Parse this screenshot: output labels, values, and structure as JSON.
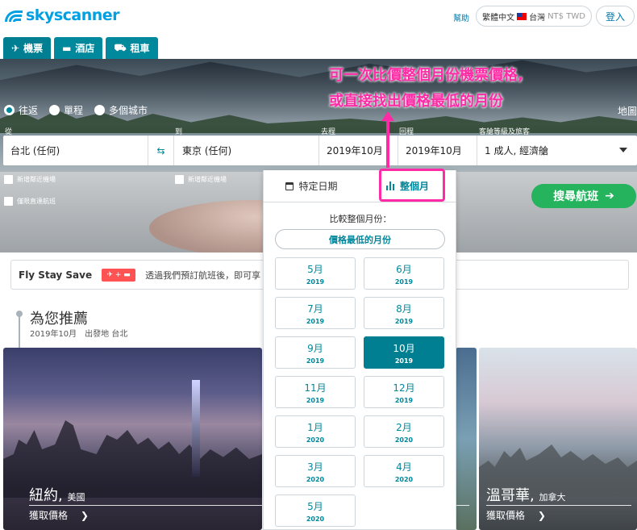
{
  "header": {
    "logo": "skyscanner",
    "help": "幫助",
    "locale": {
      "language": "繁體中文",
      "country": "台灣",
      "currency": "NT$ TWD"
    },
    "login": "登入"
  },
  "tabs": [
    {
      "label": "機票",
      "icon": "plane-icon"
    },
    {
      "label": "酒店",
      "icon": "bed-icon"
    },
    {
      "label": "租車",
      "icon": "car-icon"
    }
  ],
  "search": {
    "trip_types": [
      "往返",
      "單程",
      "多個城市"
    ],
    "trip_type_selected": "往返",
    "map": "地圖",
    "labels": {
      "from": "從",
      "to": "到",
      "depart": "去程",
      "return": "回程",
      "cabin": "客艙等級及旅客"
    },
    "from": "台北 (任何)",
    "to": "東京 (任何)",
    "depart": "2019年10月",
    "return": "2019年10月",
    "cabin": "1 成人, 經濟艙",
    "nearby_from": "新增鄰近機場",
    "nearby_to": "新增鄰近機場",
    "direct_only": "僅限直達航班",
    "search_button": "搜尋航班"
  },
  "annotation": {
    "line1": "可一次比價整個月份機票價格,",
    "line2": "或直接找出價格最低的月份"
  },
  "date_picker": {
    "tab_specific": "特定日期",
    "tab_month": "整個月",
    "compare_label": "比較整個月份：",
    "cheapest_button": "價格最低的月份",
    "months": [
      {
        "month": "5月",
        "year": "2019"
      },
      {
        "month": "6月",
        "year": "2019"
      },
      {
        "month": "7月",
        "year": "2019"
      },
      {
        "month": "8月",
        "year": "2019"
      },
      {
        "month": "9月",
        "year": "2019"
      },
      {
        "month": "10月",
        "year": "2019"
      },
      {
        "month": "11月",
        "year": "2019"
      },
      {
        "month": "12月",
        "year": "2019"
      },
      {
        "month": "1月",
        "year": "2020"
      },
      {
        "month": "2月",
        "year": "2020"
      },
      {
        "month": "3月",
        "year": "2020"
      },
      {
        "month": "4月",
        "year": "2020"
      },
      {
        "month": "5月",
        "year": "2020"
      }
    ],
    "selected": "10月 2019"
  },
  "promo": {
    "title": "Fly Stay Save",
    "text": "透過我們預訂航班後，即可享"
  },
  "recommendations": {
    "title": "為您推薦",
    "subtitle": "2019年10月　出發地 台北",
    "cards": [
      {
        "city": "紐約,",
        "country": "美國",
        "price": "獲取價格"
      },
      {
        "city": "溫哥華,",
        "country": "加拿大",
        "price": "獲取價格"
      }
    ]
  },
  "colors": {
    "brand": "#00a0e3",
    "teal": "#00889c",
    "green": "#25b35e",
    "annotation": "#ff2aa6"
  }
}
